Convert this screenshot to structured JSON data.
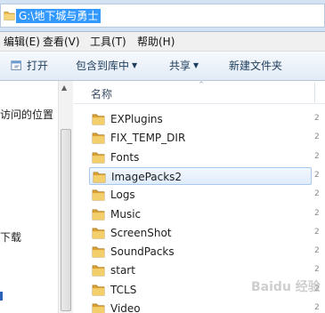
{
  "address_bar": {
    "path": "G:\\地下城与勇士"
  },
  "menu": {
    "items": [
      {
        "label": "编辑(E)"
      },
      {
        "label": "查看(V)"
      },
      {
        "label": "工具(T)"
      },
      {
        "label": "帮助(H)"
      }
    ]
  },
  "toolbar": {
    "open_label": "打开",
    "include_label": "包含到库中",
    "share_label": "共享",
    "new_folder_label": "新建文件夹",
    "dropdown_arrow": "▼"
  },
  "nav_pane": {
    "recent_places": "访问的位置",
    "downloads": "下载"
  },
  "file_list": {
    "name_header": "名称",
    "sort_indicator": "^",
    "selected_index": 3,
    "items": [
      {
        "name": "EXPlugins"
      },
      {
        "name": "FIX_TEMP_DIR"
      },
      {
        "name": "Fonts"
      },
      {
        "name": "ImagePacks2"
      },
      {
        "name": "Logs"
      },
      {
        "name": "Music"
      },
      {
        "name": "ScreenShot"
      },
      {
        "name": "SoundPacks"
      },
      {
        "name": "start"
      },
      {
        "name": "TCLS"
      },
      {
        "name": "Video"
      }
    ]
  },
  "watermark": {
    "text": "Baidu 经验"
  },
  "colors": {
    "folder": "#e8b94a",
    "selection_highlight": "#3399ff",
    "address_bg": "#d4e3f4"
  }
}
